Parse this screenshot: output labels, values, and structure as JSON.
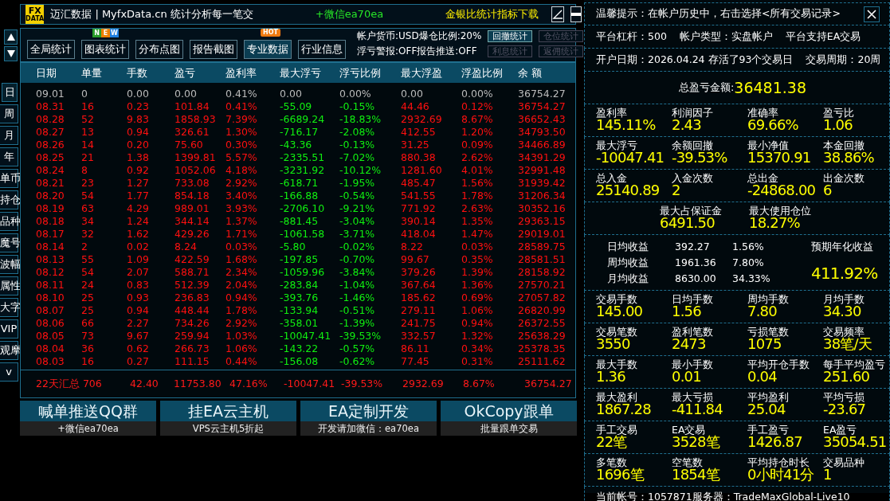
{
  "title_bar": {
    "logo": {
      "top": "FX",
      "bottom": "DATA"
    },
    "title": "迈汇数据 | MyfxData.cn  统计分析每一笔交",
    "wechat": "+微信ea70ea",
    "link": "金银比统计指标下载"
  },
  "toolbar": {
    "nav": [
      {
        "label": "全局统计",
        "selected": false
      },
      {
        "label": "图表统计",
        "selected": false,
        "badge": {
          "kind": "tiles",
          "letters": [
            "N",
            "E",
            "W"
          ]
        }
      },
      {
        "label": "分布点图",
        "selected": false
      },
      {
        "label": "报告截图",
        "selected": false
      },
      {
        "label": "专业数据",
        "selected": true,
        "badge": {
          "kind": "tag",
          "text": "HOT"
        }
      },
      {
        "label": "行业信息",
        "selected": false
      }
    ],
    "info": [
      "帐户货币:USD爆仓比例:20%",
      "浮亏警报:OFF报告推送:OFF"
    ],
    "small_buttons": [
      {
        "label": "回撤统计",
        "disabled": false
      },
      {
        "label": "仓位统计",
        "disabled": true
      },
      {
        "label": "利息统计",
        "disabled": true
      },
      {
        "label": "返佣统计",
        "disabled": true
      }
    ]
  },
  "side_tabs": [
    {
      "label": "日",
      "selected": true
    },
    {
      "label": "周",
      "selected": false
    },
    {
      "label": "月",
      "selected": false
    },
    {
      "label": "年",
      "selected": false
    },
    {
      "label": "单币",
      "selected": false
    },
    {
      "label": "持仓",
      "selected": false
    },
    {
      "label": "品种",
      "selected": false
    },
    {
      "label": "魔号",
      "selected": false
    },
    {
      "label": "波幅",
      "selected": false
    },
    {
      "label": "属性",
      "selected": false
    },
    {
      "label": "大字",
      "selected": false
    },
    {
      "label": "VIP",
      "selected": false
    },
    {
      "label": "观摩",
      "selected": false
    },
    {
      "label": "v",
      "selected": false
    }
  ],
  "table": {
    "columns": [
      "日期",
      "单量",
      "手数",
      "盈亏",
      "盈利率",
      "最大浮亏",
      "浮亏比例",
      "最大浮盈",
      "浮盈比例",
      "余 额"
    ],
    "rows": [
      {
        "kind": "open",
        "cells": [
          "09.01",
          "0",
          "0.00",
          "0.00",
          "0.41%",
          "0.00",
          "0.00%",
          "0.00",
          "0.00%",
          "36754.27"
        ]
      },
      {
        "kind": "closed",
        "cells": [
          "08.31",
          "16",
          "0.23",
          "101.84",
          "0.41%",
          "-55.09",
          "-0.15%",
          "44.46",
          "0.12%",
          "36754.27"
        ]
      },
      {
        "kind": "closed",
        "cells": [
          "08.28",
          "52",
          "9.83",
          "1858.93",
          "7.39%",
          "-6689.24",
          "-18.83%",
          "2932.69",
          "8.67%",
          "36652.43"
        ]
      },
      {
        "kind": "closed",
        "cells": [
          "08.27",
          "13",
          "0.94",
          "326.61",
          "1.30%",
          "-716.17",
          "-2.08%",
          "412.55",
          "1.20%",
          "34793.50"
        ]
      },
      {
        "kind": "closed",
        "cells": [
          "08.26",
          "14",
          "0.20",
          "75.60",
          "0.30%",
          "-43.36",
          "-0.13%",
          "31.25",
          "0.09%",
          "34466.89"
        ]
      },
      {
        "kind": "closed",
        "cells": [
          "08.25",
          "21",
          "1.38",
          "1399.81",
          "5.57%",
          "-2335.51",
          "-7.02%",
          "880.38",
          "2.62%",
          "34391.29"
        ]
      },
      {
        "kind": "closed",
        "cells": [
          "08.24",
          "8",
          "0.92",
          "1052.06",
          "4.18%",
          "-3231.92",
          "-10.12%",
          "1281.60",
          "4.01%",
          "32991.48"
        ]
      },
      {
        "kind": "closed",
        "cells": [
          "08.21",
          "23",
          "1.27",
          "733.08",
          "2.92%",
          "-618.71",
          "-1.95%",
          "485.47",
          "1.56%",
          "31939.42"
        ]
      },
      {
        "kind": "closed",
        "cells": [
          "08.20",
          "54",
          "1.77",
          "854.18",
          "3.40%",
          "-166.88",
          "-0.54%",
          "541.55",
          "1.78%",
          "31206.34"
        ]
      },
      {
        "kind": "closed",
        "cells": [
          "08.19",
          "63",
          "4.29",
          "989.01",
          "3.93%",
          "-2706.10",
          "-9.21%",
          "771.92",
          "2.63%",
          "30352.16"
        ]
      },
      {
        "kind": "closed",
        "cells": [
          "08.18",
          "34",
          "1.24",
          "344.14",
          "1.37%",
          "-881.45",
          "-3.04%",
          "390.14",
          "1.35%",
          "29363.15"
        ]
      },
      {
        "kind": "closed",
        "cells": [
          "08.17",
          "32",
          "1.62",
          "429.26",
          "1.71%",
          "-1061.58",
          "-3.71%",
          "418.04",
          "1.47%",
          "29019.01"
        ]
      },
      {
        "kind": "closed",
        "cells": [
          "08.14",
          "2",
          "0.02",
          "8.24",
          "0.03%",
          "-5.80",
          "-0.02%",
          "8.22",
          "0.03%",
          "28589.75"
        ]
      },
      {
        "kind": "closed",
        "cells": [
          "08.13",
          "55",
          "1.09",
          "422.59",
          "1.68%",
          "-197.85",
          "-0.70%",
          "99.67",
          "0.35%",
          "28581.51"
        ]
      },
      {
        "kind": "closed",
        "cells": [
          "08.12",
          "54",
          "2.07",
          "588.71",
          "2.34%",
          "-1059.96",
          "-3.84%",
          "379.26",
          "1.39%",
          "28158.92"
        ]
      },
      {
        "kind": "closed",
        "cells": [
          "08.11",
          "24",
          "0.83",
          "512.39",
          "2.04%",
          "-283.84",
          "-1.04%",
          "367.64",
          "1.36%",
          "27570.21"
        ]
      },
      {
        "kind": "closed",
        "cells": [
          "08.10",
          "25",
          "0.93",
          "236.83",
          "0.94%",
          "-393.76",
          "-1.46%",
          "185.62",
          "0.69%",
          "27057.82"
        ]
      },
      {
        "kind": "closed",
        "cells": [
          "08.07",
          "25",
          "0.94",
          "448.44",
          "1.78%",
          "-133.94",
          "-0.51%",
          "279.11",
          "1.06%",
          "26820.99"
        ]
      },
      {
        "kind": "closed",
        "cells": [
          "08.06",
          "66",
          "2.27",
          "734.26",
          "2.92%",
          "-358.01",
          "-1.39%",
          "241.75",
          "0.94%",
          "26372.55"
        ]
      },
      {
        "kind": "closed",
        "cells": [
          "08.05",
          "73",
          "9.67",
          "259.94",
          "1.03%",
          "-10047.41",
          "-39.53%",
          "332.57",
          "1.32%",
          "25638.29"
        ]
      },
      {
        "kind": "closed",
        "cells": [
          "08.04",
          "36",
          "0.62",
          "266.73",
          "1.06%",
          "-143.22",
          "-0.57%",
          "86.11",
          "0.34%",
          "25378.35"
        ]
      },
      {
        "kind": "closed",
        "cells": [
          "08.03",
          "16",
          "0.27",
          "111.15",
          "0.44%",
          "-156.08",
          "-0.62%",
          "77.45",
          "0.31%",
          "25111.62"
        ]
      }
    ],
    "summary": [
      "22天汇总 706",
      "42.40",
      "11753.80",
      "47.16%",
      "-10047.41",
      "-39.53%",
      "2932.69",
      "8.67%",
      "36754.27"
    ]
  },
  "promos": [
    {
      "title": "喊单推送QQ群",
      "subtitle": "+微信ea70ea"
    },
    {
      "title": "挂EA云主机",
      "subtitle": "VPS云主机5折起"
    },
    {
      "title": "EA定制开发",
      "subtitle": "开发请加微信：ea70ea"
    },
    {
      "title": "OkCopy跟单",
      "subtitle": "批量跟单交易"
    }
  ],
  "panel": {
    "notice": "温馨提示：在帐户历史中，右击选择<所有交易记录>",
    "info_lines": [
      [
        "平台杠杆：500",
        "帐户类型：实盘帐户",
        "平台支持EA交易"
      ],
      [
        "开户日期：2026.04.24 存活了93个交易日",
        "交易周期：20周"
      ]
    ],
    "total": {
      "label": "总盈亏金额:",
      "value": "36481.38"
    },
    "groups": [
      {
        "kind": "grid",
        "items": [
          {
            "label": "盈利率",
            "value": "145.11%"
          },
          {
            "label": "利润因子",
            "value": "2.43"
          },
          {
            "label": "准确率",
            "value": "69.66%"
          },
          {
            "label": "盈亏比",
            "value": "1.06"
          }
        ]
      },
      {
        "kind": "grid",
        "items": [
          {
            "label": "最大浮亏",
            "value": "-10047.41"
          },
          {
            "label": "余额回撤",
            "value": "-39.53%"
          },
          {
            "label": "最小净值",
            "value": "15370.91"
          },
          {
            "label": "本金回撤",
            "value": "38.86%"
          }
        ]
      },
      {
        "kind": "grid",
        "items": [
          {
            "label": "总入金",
            "value": "25140.89"
          },
          {
            "label": "入金次数",
            "value": "2"
          },
          {
            "label": "总出金",
            "value": "-24868.00"
          },
          {
            "label": "出金次数",
            "value": "6"
          }
        ]
      },
      {
        "kind": "centered",
        "items": [
          {
            "label": "最大占保证金",
            "value": "6491.50"
          },
          {
            "label": "最大使用仓位",
            "value": "18.27%"
          }
        ]
      },
      {
        "kind": "averages",
        "rows": [
          [
            "日均收益",
            "392.27",
            "1.56%"
          ],
          [
            "周均收益",
            "1961.36",
            "7.80%"
          ],
          [
            "月均收益",
            "8630.00",
            "34.33%"
          ]
        ],
        "side": {
          "label": "预期年化收益",
          "value": "411.92%"
        }
      },
      {
        "kind": "grid",
        "items": [
          {
            "label": "交易手数",
            "value": "145.00"
          },
          {
            "label": "日均手数",
            "value": "1.56"
          },
          {
            "label": "周均手数",
            "value": "7.80"
          },
          {
            "label": "月均手数",
            "value": "34.30"
          }
        ]
      },
      {
        "kind": "grid",
        "items": [
          {
            "label": "交易笔数",
            "value": "3550"
          },
          {
            "label": "盈利笔数",
            "value": "2473"
          },
          {
            "label": "亏损笔数",
            "value": "1075"
          },
          {
            "label": "交易频率",
            "value": "38笔/天"
          }
        ]
      },
      {
        "kind": "grid",
        "items": [
          {
            "label": "最大手数",
            "value": "1.36"
          },
          {
            "label": "最小手数",
            "value": "0.01"
          },
          {
            "label": "平均开仓手数",
            "value": "0.04"
          },
          {
            "label": "每手平均盈亏",
            "value": "251.60"
          }
        ]
      },
      {
        "kind": "grid",
        "items": [
          {
            "label": "最大盈利",
            "value": "1867.28"
          },
          {
            "label": "最大亏损",
            "value": "-411.84"
          },
          {
            "label": "平均盈利",
            "value": "25.04"
          },
          {
            "label": "平均亏损",
            "value": "-23.67"
          }
        ]
      },
      {
        "kind": "grid",
        "items": [
          {
            "label": "手工交易",
            "value": "22笔"
          },
          {
            "label": "EA交易",
            "value": "3528笔"
          },
          {
            "label": "手工盈亏",
            "value": "1426.87"
          },
          {
            "label": "EA盈亏",
            "value": "35054.51"
          }
        ]
      },
      {
        "kind": "grid",
        "items": [
          {
            "label": "多笔数",
            "value": "1696笔"
          },
          {
            "label": "空笔数",
            "value": "1854笔"
          },
          {
            "label": "平均持仓时长",
            "value": "0小时41分"
          },
          {
            "label": "交易品种",
            "value": "1"
          }
        ]
      }
    ],
    "footer": "当前帐号：1057871服务器：TradeMaxGlobal-Live10"
  }
}
